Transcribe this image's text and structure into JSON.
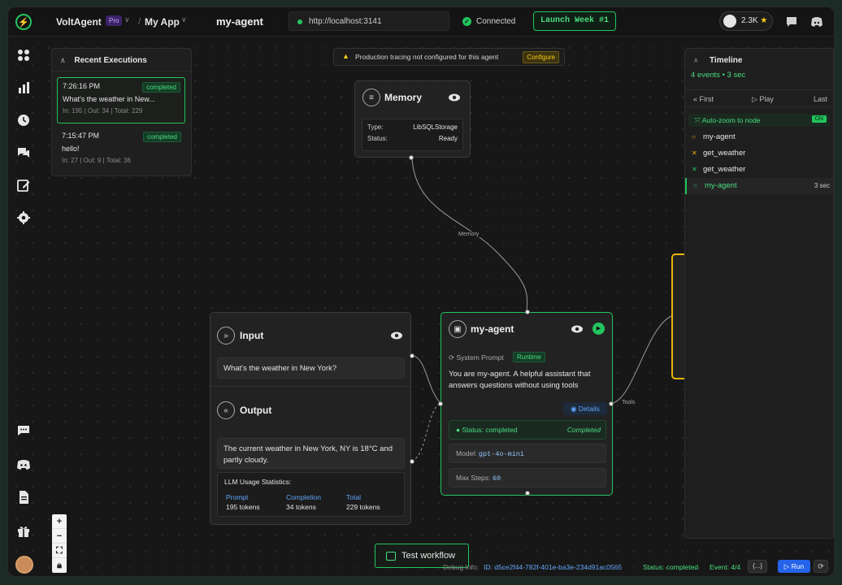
{
  "topbar": {
    "brand": "VoltAgent",
    "pro_badge": "Pro",
    "app_name": "My App",
    "agent_title": "my-agent",
    "url": "http://localhost:3141",
    "connection_status": "Connected",
    "launch_button": "Launch Week #1",
    "github_stars": "2.3K"
  },
  "recent_executions": {
    "title": "Recent Executions",
    "items": [
      {
        "time": "7:26:16 PM",
        "status": "completed",
        "message": "What's the weather in New...",
        "stats": "In: 195 | Out: 34 | Total: 229"
      },
      {
        "time": "7:15:47 PM",
        "status": "completed",
        "message": "hello!",
        "stats": "In: 27 | Out: 9 | Total: 36"
      }
    ]
  },
  "banner": {
    "text": "Production tracing not configured for this agent",
    "configure_label": "Configure"
  },
  "memory_node": {
    "title": "Memory",
    "type_label": "Type:",
    "type_value": "LibSQLStorage",
    "status_label": "Status:",
    "status_value": "Ready",
    "edge_label": "Memory"
  },
  "io_node": {
    "input_title": "Input",
    "input_text": "What's the weather in New York?",
    "output_title": "Output",
    "output_text": "The current weather in New York, NY is 18°C and partly cloudy.",
    "stats_title": "LLM Usage Statistics:",
    "prompt_label": "Prompt",
    "prompt_value": "195 tokens",
    "completion_label": "Completion",
    "completion_value": "34 tokens",
    "total_label": "Total",
    "total_value": "229 tokens"
  },
  "agent_node": {
    "title": "my-agent",
    "system_prompt_label": "System Prompt",
    "runtime_badge": "Runtime",
    "prompt_text": "You are my-agent. A helpful assistant that answers questions without using tools",
    "details_label": "Details",
    "status_label": "Status: completed",
    "status_right": "Completed",
    "model_label": "Model:",
    "model_value": "gpt-4o-mini",
    "max_steps_label": "Max Steps:",
    "max_steps_value": "60",
    "tools_edge_label": "Tools"
  },
  "timeline": {
    "title": "Timeline",
    "subtitle": "4 events • 3 sec",
    "first_label": "First",
    "play_label": "Play",
    "last_label": "Last",
    "autozoom_label": "Auto-zoom to node",
    "autozoom_state": "ON",
    "events": [
      {
        "name": "my-agent",
        "icon": "○",
        "color": "#eab308",
        "duration": ""
      },
      {
        "name": "get_weather",
        "icon": "✕",
        "color": "#eab308",
        "duration": ""
      },
      {
        "name": "get_weather",
        "icon": "✕",
        "color": "#22c55e",
        "duration": ""
      },
      {
        "name": "my-agent",
        "icon": "○",
        "color": "#22c55e",
        "duration": "3 sec"
      }
    ]
  },
  "bottom": {
    "test_button": "Test workflow",
    "debug_prefix": "Debug Info:",
    "debug_id": "ID: d5ce2f44-782f-401e-ba3e-234d91ac0565",
    "debug_status": "Status: completed",
    "debug_event": "Event: 4/4",
    "dots_label": "{...}",
    "run_label": "Run"
  },
  "colors": {
    "accent": "#22c55e",
    "link": "#60a5fa",
    "warning": "#facc15"
  }
}
